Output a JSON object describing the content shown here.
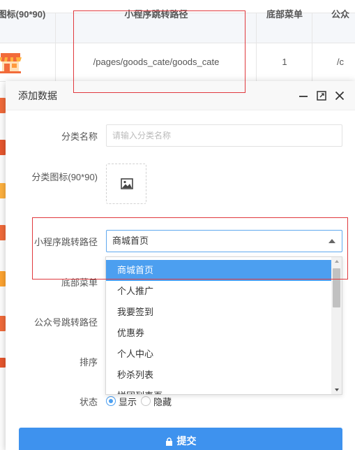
{
  "table": {
    "col_icon_header": "图标(90*90)",
    "col_path_header": "小程序跳转路径",
    "col_menu_header": "底部菜单",
    "col_gzh_header": "公众",
    "row1": {
      "path": "/pages/goods_cate/goods_cate",
      "menu": "1",
      "gzh": "/c"
    }
  },
  "modal": {
    "title": "添加数据",
    "fields": {
      "name_label": "分类名称",
      "name_placeholder": "请输入分类名称",
      "icon_label": "分类图标(90*90)",
      "path_label": "小程序跳转路径",
      "path_value": "商城首页",
      "menu_label": "底部菜单",
      "gzh_label": "公众号跳转路径",
      "sort_label": "排序",
      "status_label": "状态",
      "status_show": "显示",
      "status_hide": "隐藏"
    },
    "dropdown_options": [
      "商城首页",
      "个人推广",
      "我要签到",
      "优惠券",
      "个人中心",
      "秒杀列表",
      "拼团列表页"
    ],
    "selected_option": "商城首页",
    "submit_label": "提交"
  },
  "colors": {
    "accent": "#3e92ee",
    "highlight_box": "#e0393e",
    "selected_option_bg": "#4c9ff0",
    "icon_orange": "#f26b3a"
  },
  "icons": {
    "minimize": "minimize-icon",
    "maximize": "maximize-icon",
    "close": "close-icon",
    "image_placeholder": "image-icon",
    "submit": "lock-icon",
    "store": "store-icon"
  }
}
